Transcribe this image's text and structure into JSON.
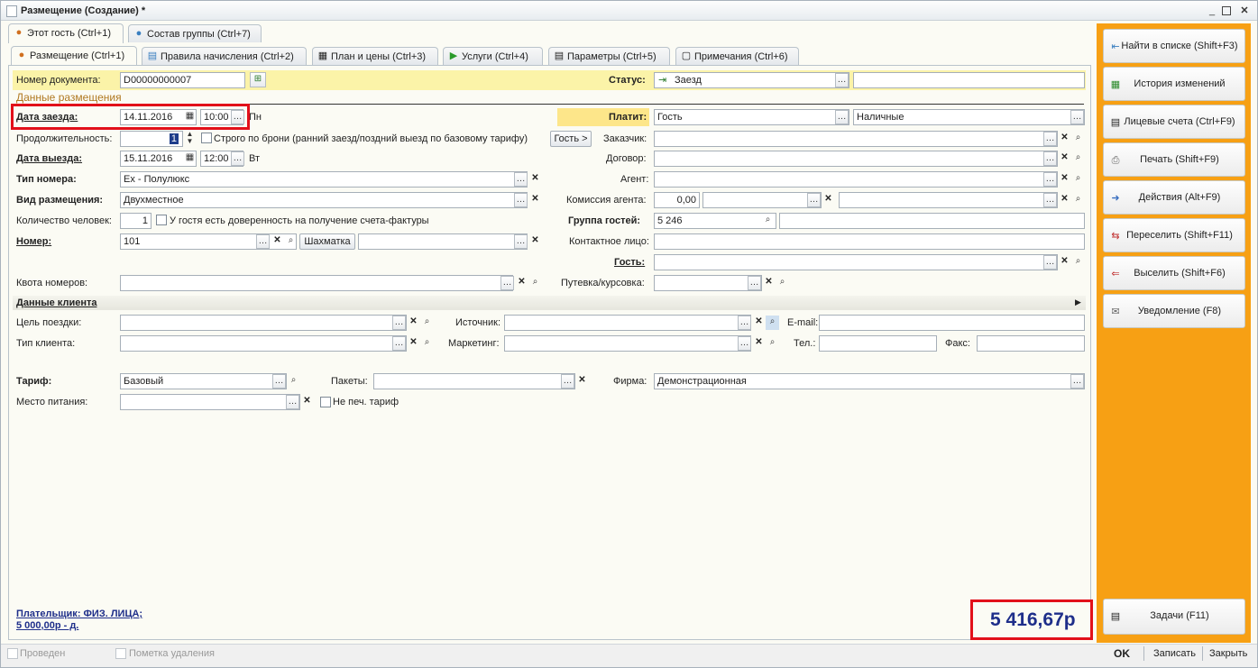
{
  "window": {
    "title": "Размещение (Создание) *"
  },
  "top_tabs": [
    {
      "label": "Этот гость (Ctrl+1)",
      "icon": "person-icon"
    },
    {
      "label": "Состав группы (Ctrl+7)",
      "icon": "group-icon"
    }
  ],
  "sub_tabs": [
    {
      "label": "Размещение (Ctrl+1)",
      "icon": "person-icon"
    },
    {
      "label": "Правила начисления (Ctrl+2)",
      "icon": "rules-icon"
    },
    {
      "label": "План и цены (Ctrl+3)",
      "icon": "table-icon"
    },
    {
      "label": "Услуги (Ctrl+4)",
      "icon": "play-icon"
    },
    {
      "label": "Параметры (Ctrl+5)",
      "icon": "list-icon"
    },
    {
      "label": "Примечания (Ctrl+6)",
      "icon": "note-icon"
    }
  ],
  "form": {
    "doc_number_label": "Номер документа:",
    "doc_number": "D00000000007",
    "status_label": "Статус:",
    "status_value": "Заезд",
    "section_placement": "Данные размещения",
    "checkin_label": "Дата заезда:",
    "checkin_date": "14.11.2016",
    "checkin_time": "10:00",
    "checkin_day": "Пн",
    "duration_label": "Продолжительность:",
    "duration_value": "1",
    "strict_label": "Строго по брони (ранний заезд/поздний выезд по базовому тарифу)",
    "guest_btn": "Гость >",
    "checkout_label": "Дата выезда:",
    "checkout_date": "15.11.2016",
    "checkout_time": "12:00",
    "checkout_day": "Вт",
    "room_type_label": "Тип номера:",
    "room_type_value": "Ex - Полулюкс",
    "accom_type_label": "Вид размещения:",
    "accom_type_value": "Двухместное",
    "persons_label": "Количество человек:",
    "persons_value": "1",
    "proxy_label": "У гостя есть доверенность на получение счета-фактуры",
    "room_label": "Номер:",
    "room_value": "101",
    "chess_btn": "Шахматка",
    "quota_label": "Квота номеров:",
    "pays_label": "Платит:",
    "pays_value": "Гость",
    "pays_method": "Наличные",
    "customer_label": "Заказчик:",
    "contract_label": "Договор:",
    "agent_label": "Агент:",
    "commission_label": "Комиссия агента:",
    "commission_value": "0,00",
    "group_label": "Группа гостей:",
    "group_value": "5 246",
    "contact_label": "Контактное лицо:",
    "guest_label": "Гость:",
    "voucher_label": "Путевка/курсовка:",
    "section_client": "Данные клиента",
    "trip_purpose_label": "Цель поездки:",
    "client_type_label": "Тип клиента:",
    "source_label": "Источник:",
    "marketing_label": "Маркетинг:",
    "email_label": "E-mail:",
    "phone_label": "Тел.:",
    "fax_label": "Факс:",
    "tariff_label": "Тариф:",
    "tariff_value": "Базовый",
    "packages_label": "Пакеты:",
    "firm_label": "Фирма:",
    "firm_value": "Демонстрационная",
    "meal_label": "Место питания:",
    "no_print_label": "Не печ. тариф",
    "payer_line1": "Плательщик: ФИЗ. ЛИЦА;",
    "payer_line2": "5 000,00р - д.",
    "total": "5 416,67р"
  },
  "right_panel": {
    "color": "#f7a014",
    "buttons": [
      {
        "label": "Найти в списке (Shift+F3)",
        "icon": "find-icon"
      },
      {
        "label": "История изменений",
        "icon": "history-icon"
      },
      {
        "label": "Лицевые счета (Ctrl+F9)",
        "icon": "accounts-icon"
      },
      {
        "label": "Печать (Shift+F9)",
        "icon": "print-icon"
      },
      {
        "label": "Действия (Alt+F9)",
        "icon": "actions-icon"
      },
      {
        "label": "Переселить (Shift+F11)",
        "icon": "move-icon"
      },
      {
        "label": "Выселить (Shift+F6)",
        "icon": "evict-icon"
      },
      {
        "label": "Уведомление (F8)",
        "icon": "notify-icon"
      }
    ],
    "tasks": {
      "label": "Задачи (F11)",
      "icon": "tasks-icon"
    }
  },
  "footer": {
    "posted_label": "Проведен",
    "deletion_label": "Пометка удаления",
    "ok": "OK",
    "save": "Записать",
    "close": "Закрыть"
  },
  "highlight_color": "#e2101a"
}
